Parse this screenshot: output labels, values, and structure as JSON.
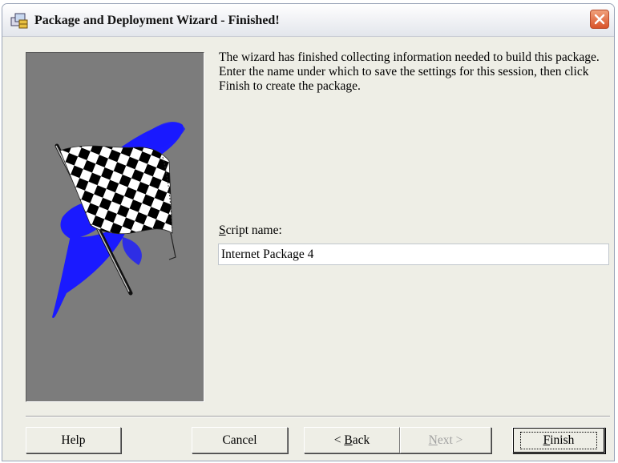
{
  "window": {
    "title": "Package and Deployment Wizard - Finished!"
  },
  "intro": {
    "text": "The wizard has finished collecting information needed to build this package. Enter the name under which to save the settings for this session, then click Finish to create the package."
  },
  "script": {
    "label_first": "S",
    "label_rest": "cript name:",
    "value": "Internet Package 4"
  },
  "buttons": {
    "help": "Help",
    "cancel": "Cancel",
    "back_prefix": "< ",
    "back_key": "B",
    "back_rest": "ack",
    "next_key": "N",
    "next_rest": "ext >",
    "finish_key": "F",
    "finish_rest": "inish"
  },
  "colors": {
    "panel": "#7c7c7c",
    "flag_swoosh": "#1a1aff"
  },
  "icons": {
    "window": "package-icon",
    "close": "close-icon",
    "art": "checkered-flag-image"
  }
}
